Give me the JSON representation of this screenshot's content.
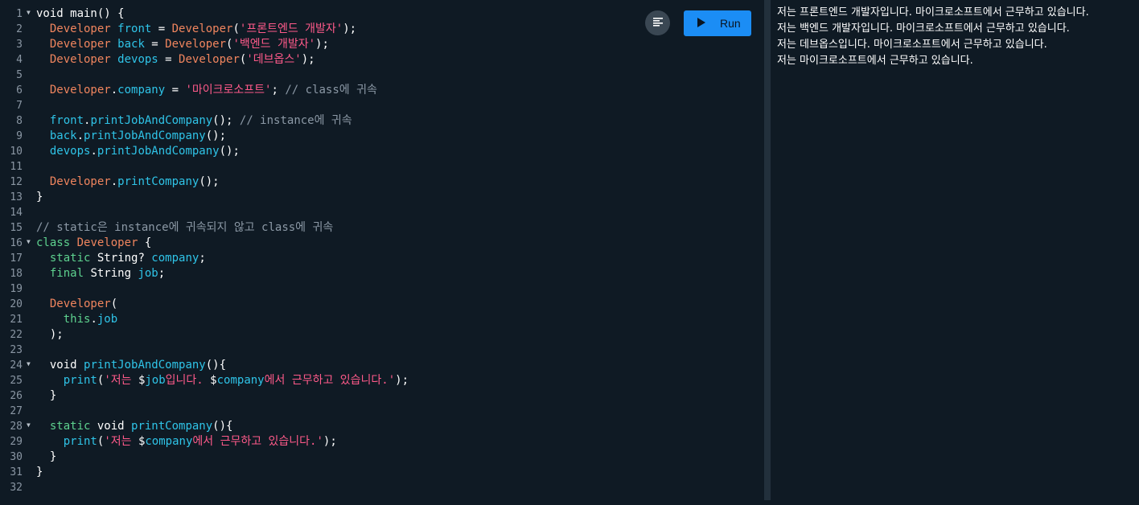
{
  "toolbar": {
    "run_label": "Run"
  },
  "icons": {
    "format": "format-align-icon",
    "run": "play-icon"
  },
  "colors": {
    "background": "#0f1a24",
    "run_button": "#1b8df5",
    "keyword": "#5ed28f",
    "type": "#f0855e",
    "function": "#2fc4e8",
    "string": "#ff5a8a",
    "comment": "#8c99a6"
  },
  "editor": {
    "lines": [
      {
        "n": "1",
        "fold": true,
        "tokens": [
          {
            "c": "pl",
            "t": "void main() {"
          }
        ]
      },
      {
        "n": "2",
        "fold": false,
        "tokens": [
          {
            "c": "pl",
            "t": "  "
          },
          {
            "c": "ty",
            "t": "Developer"
          },
          {
            "c": "pl",
            "t": " "
          },
          {
            "c": "fn",
            "t": "front"
          },
          {
            "c": "pl",
            "t": " = "
          },
          {
            "c": "ty",
            "t": "Developer"
          },
          {
            "c": "pl",
            "t": "("
          },
          {
            "c": "st",
            "t": "'프론트엔드 개발자'"
          },
          {
            "c": "pl",
            "t": ");"
          }
        ]
      },
      {
        "n": "3",
        "fold": false,
        "tokens": [
          {
            "c": "pl",
            "t": "  "
          },
          {
            "c": "ty",
            "t": "Developer"
          },
          {
            "c": "pl",
            "t": " "
          },
          {
            "c": "fn",
            "t": "back"
          },
          {
            "c": "pl",
            "t": " = "
          },
          {
            "c": "ty",
            "t": "Developer"
          },
          {
            "c": "pl",
            "t": "("
          },
          {
            "c": "st",
            "t": "'백엔드 개발자'"
          },
          {
            "c": "pl",
            "t": ");"
          }
        ]
      },
      {
        "n": "4",
        "fold": false,
        "tokens": [
          {
            "c": "pl",
            "t": "  "
          },
          {
            "c": "ty",
            "t": "Developer"
          },
          {
            "c": "pl",
            "t": " "
          },
          {
            "c": "fn",
            "t": "devops"
          },
          {
            "c": "pl",
            "t": " = "
          },
          {
            "c": "ty",
            "t": "Developer"
          },
          {
            "c": "pl",
            "t": "("
          },
          {
            "c": "st",
            "t": "'데브옵스'"
          },
          {
            "c": "pl",
            "t": ");"
          }
        ]
      },
      {
        "n": "5",
        "fold": false,
        "tokens": []
      },
      {
        "n": "6",
        "fold": false,
        "tokens": [
          {
            "c": "pl",
            "t": "  "
          },
          {
            "c": "ty",
            "t": "Developer"
          },
          {
            "c": "pl",
            "t": "."
          },
          {
            "c": "fn",
            "t": "company"
          },
          {
            "c": "pl",
            "t": " = "
          },
          {
            "c": "st",
            "t": "'마이크로소프트'"
          },
          {
            "c": "pl",
            "t": "; "
          },
          {
            "c": "cm",
            "t": "// class에 귀속"
          }
        ]
      },
      {
        "n": "7",
        "fold": false,
        "tokens": []
      },
      {
        "n": "8",
        "fold": false,
        "tokens": [
          {
            "c": "pl",
            "t": "  "
          },
          {
            "c": "fn",
            "t": "front"
          },
          {
            "c": "pl",
            "t": "."
          },
          {
            "c": "fn",
            "t": "printJobAndCompany"
          },
          {
            "c": "pl",
            "t": "(); "
          },
          {
            "c": "cm",
            "t": "// instance에 귀속"
          }
        ]
      },
      {
        "n": "9",
        "fold": false,
        "tokens": [
          {
            "c": "pl",
            "t": "  "
          },
          {
            "c": "fn",
            "t": "back"
          },
          {
            "c": "pl",
            "t": "."
          },
          {
            "c": "fn",
            "t": "printJobAndCompany"
          },
          {
            "c": "pl",
            "t": "();"
          }
        ]
      },
      {
        "n": "10",
        "fold": false,
        "tokens": [
          {
            "c": "pl",
            "t": "  "
          },
          {
            "c": "fn",
            "t": "devops"
          },
          {
            "c": "pl",
            "t": "."
          },
          {
            "c": "fn",
            "t": "printJobAndCompany"
          },
          {
            "c": "pl",
            "t": "();"
          }
        ]
      },
      {
        "n": "11",
        "fold": false,
        "tokens": []
      },
      {
        "n": "12",
        "fold": false,
        "tokens": [
          {
            "c": "pl",
            "t": "  "
          },
          {
            "c": "ty",
            "t": "Developer"
          },
          {
            "c": "pl",
            "t": "."
          },
          {
            "c": "fn",
            "t": "printCompany"
          },
          {
            "c": "pl",
            "t": "();"
          }
        ]
      },
      {
        "n": "13",
        "fold": false,
        "tokens": [
          {
            "c": "pl",
            "t": "}"
          }
        ]
      },
      {
        "n": "14",
        "fold": false,
        "tokens": []
      },
      {
        "n": "15",
        "fold": false,
        "tokens": [
          {
            "c": "cm",
            "t": "// static은 instance에 귀속되지 않고 class에 귀속"
          }
        ]
      },
      {
        "n": "16",
        "fold": true,
        "tokens": [
          {
            "c": "kw",
            "t": "class"
          },
          {
            "c": "pl",
            "t": " "
          },
          {
            "c": "ty",
            "t": "Developer"
          },
          {
            "c": "pl",
            "t": " {"
          }
        ]
      },
      {
        "n": "17",
        "fold": false,
        "tokens": [
          {
            "c": "pl",
            "t": "  "
          },
          {
            "c": "kw",
            "t": "static"
          },
          {
            "c": "pl",
            "t": " String? "
          },
          {
            "c": "fn",
            "t": "company"
          },
          {
            "c": "pl",
            "t": ";"
          }
        ]
      },
      {
        "n": "18",
        "fold": false,
        "tokens": [
          {
            "c": "pl",
            "t": "  "
          },
          {
            "c": "kw",
            "t": "final"
          },
          {
            "c": "pl",
            "t": " String "
          },
          {
            "c": "fn",
            "t": "job"
          },
          {
            "c": "pl",
            "t": ";"
          }
        ]
      },
      {
        "n": "19",
        "fold": false,
        "tokens": []
      },
      {
        "n": "20",
        "fold": false,
        "tokens": [
          {
            "c": "pl",
            "t": "  "
          },
          {
            "c": "ty",
            "t": "Developer"
          },
          {
            "c": "pl",
            "t": "("
          }
        ]
      },
      {
        "n": "21",
        "fold": false,
        "tokens": [
          {
            "c": "pl",
            "t": "    "
          },
          {
            "c": "kw",
            "t": "this"
          },
          {
            "c": "pl",
            "t": "."
          },
          {
            "c": "fn",
            "t": "job"
          }
        ]
      },
      {
        "n": "22",
        "fold": false,
        "tokens": [
          {
            "c": "pl",
            "t": "  );"
          }
        ]
      },
      {
        "n": "23",
        "fold": false,
        "tokens": []
      },
      {
        "n": "24",
        "fold": true,
        "tokens": [
          {
            "c": "pl",
            "t": "  void "
          },
          {
            "c": "fn",
            "t": "printJobAndCompany"
          },
          {
            "c": "pl",
            "t": "(){"
          }
        ]
      },
      {
        "n": "25",
        "fold": false,
        "tokens": [
          {
            "c": "pl",
            "t": "    "
          },
          {
            "c": "fn",
            "t": "print"
          },
          {
            "c": "pl",
            "t": "("
          },
          {
            "c": "st",
            "t": "'저는 "
          },
          {
            "c": "pl",
            "t": "$"
          },
          {
            "c": "fn",
            "t": "job"
          },
          {
            "c": "st",
            "t": "입니다. "
          },
          {
            "c": "pl",
            "t": "$"
          },
          {
            "c": "fn",
            "t": "company"
          },
          {
            "c": "st",
            "t": "에서 근무하고 있습니다.'"
          },
          {
            "c": "pl",
            "t": ");"
          }
        ]
      },
      {
        "n": "26",
        "fold": false,
        "tokens": [
          {
            "c": "pl",
            "t": "  }"
          }
        ]
      },
      {
        "n": "27",
        "fold": false,
        "tokens": []
      },
      {
        "n": "28",
        "fold": true,
        "tokens": [
          {
            "c": "pl",
            "t": "  "
          },
          {
            "c": "kw",
            "t": "static"
          },
          {
            "c": "pl",
            "t": " void "
          },
          {
            "c": "fn",
            "t": "printCompany"
          },
          {
            "c": "pl",
            "t": "(){"
          }
        ]
      },
      {
        "n": "29",
        "fold": false,
        "tokens": [
          {
            "c": "pl",
            "t": "    "
          },
          {
            "c": "fn",
            "t": "print"
          },
          {
            "c": "pl",
            "t": "("
          },
          {
            "c": "st",
            "t": "'저는 "
          },
          {
            "c": "pl",
            "t": "$"
          },
          {
            "c": "fn",
            "t": "company"
          },
          {
            "c": "st",
            "t": "에서 근무하고 있습니다.'"
          },
          {
            "c": "pl",
            "t": ");"
          }
        ]
      },
      {
        "n": "30",
        "fold": false,
        "tokens": [
          {
            "c": "pl",
            "t": "  }"
          }
        ]
      },
      {
        "n": "31",
        "fold": false,
        "tokens": [
          {
            "c": "pl",
            "t": "}"
          }
        ]
      },
      {
        "n": "32",
        "fold": false,
        "tokens": []
      }
    ]
  },
  "console": {
    "lines": [
      "저는 프론트엔드 개발자입니다. 마이크로소프트에서 근무하고 있습니다.",
      "저는 백엔드 개발자입니다. 마이크로소프트에서 근무하고 있습니다.",
      "저는 데브옵스입니다. 마이크로소프트에서 근무하고 있습니다.",
      "저는 마이크로소프트에서 근무하고 있습니다."
    ]
  }
}
